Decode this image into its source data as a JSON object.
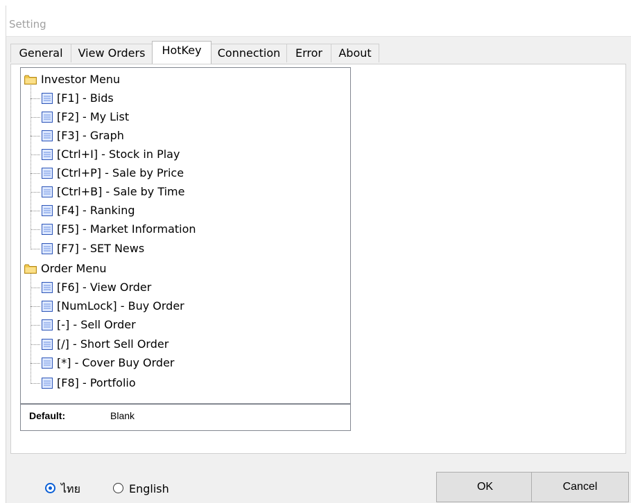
{
  "window": {
    "title": "Setting"
  },
  "tabs": [
    {
      "label": "General",
      "active": false
    },
    {
      "label": "View Orders",
      "active": false
    },
    {
      "label": "HotKey",
      "active": true
    },
    {
      "label": "Connection",
      "active": false
    },
    {
      "label": "Error",
      "active": false
    },
    {
      "label": "About",
      "active": false
    }
  ],
  "tree": {
    "groups": [
      {
        "label": "Investor Menu",
        "icon": "folder-icon",
        "items": [
          {
            "label": "[F1] - Bids",
            "icon": "document-icon"
          },
          {
            "label": "[F2] - My List",
            "icon": "document-icon"
          },
          {
            "label": "[F3] - Graph",
            "icon": "document-icon"
          },
          {
            "label": "[Ctrl+I] - Stock in Play",
            "icon": "document-icon"
          },
          {
            "label": "[Ctrl+P] - Sale by Price",
            "icon": "document-icon"
          },
          {
            "label": "[Ctrl+B] - Sale by Time",
            "icon": "document-icon"
          },
          {
            "label": "[F4] - Ranking",
            "icon": "document-icon"
          },
          {
            "label": "[F5] - Market Information",
            "icon": "document-icon"
          },
          {
            "label": "[F7] - SET News",
            "icon": "document-icon"
          }
        ]
      },
      {
        "label": "Order Menu",
        "icon": "folder-icon",
        "items": [
          {
            "label": "[F6] - View Order",
            "icon": "document-icon"
          },
          {
            "label": "[NumLock] - Buy Order",
            "icon": "document-icon"
          },
          {
            "label": "[-] - Sell Order",
            "icon": "document-icon"
          },
          {
            "label": "[/] - Short Sell Order",
            "icon": "document-icon"
          },
          {
            "label": "[*] - Cover Buy Order",
            "icon": "document-icon"
          },
          {
            "label": "[F8] - Portfolio",
            "icon": "document-icon"
          }
        ]
      }
    ]
  },
  "default_info": {
    "label": "Default:",
    "value": "Blank"
  },
  "language": {
    "options": [
      {
        "label": "ไทย",
        "checked": true
      },
      {
        "label": "English",
        "checked": false
      }
    ]
  },
  "buttons": {
    "ok": "OK",
    "cancel": "Cancel"
  },
  "colors": {
    "radio_accent": "#0a5fd6",
    "folder": "#f2c94c",
    "document": "#3f6fd1"
  }
}
